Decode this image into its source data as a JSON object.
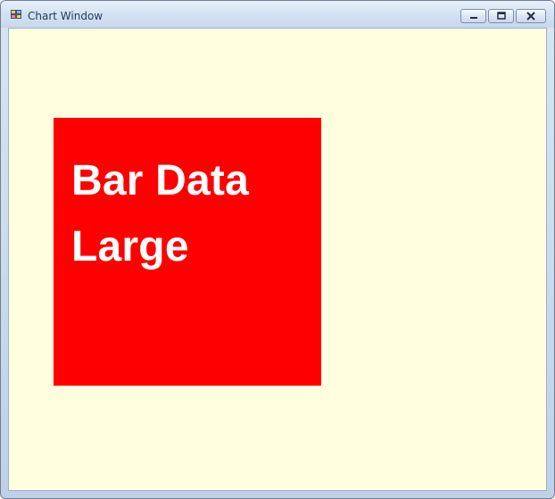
{
  "window": {
    "title": "Chart Window"
  },
  "controls": {
    "minimize": "minimize",
    "maximize": "maximize",
    "close": "close"
  },
  "tile": {
    "line1": "Bar Data",
    "line2": "Large",
    "background": "#ff0000",
    "text_color": "#ffffff"
  },
  "colors": {
    "client_background": "#ffffe0",
    "title_text": "#1e395b"
  }
}
